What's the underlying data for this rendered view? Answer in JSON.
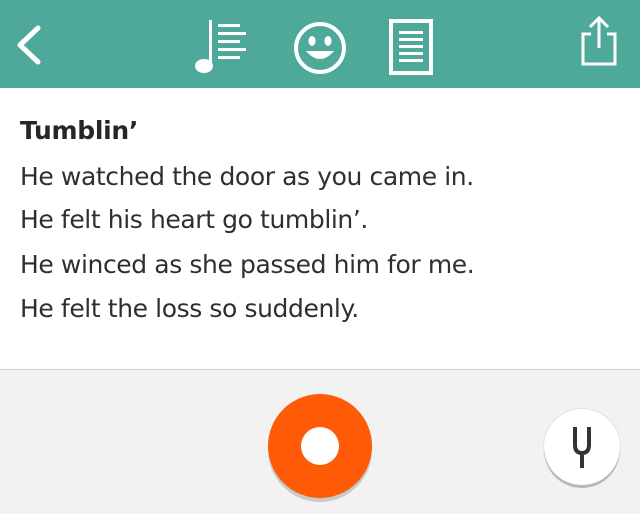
{
  "toolbar": {
    "icons": [
      "back-chevron-icon",
      "lyrics-notes-icon",
      "smiley-icon",
      "document-icon",
      "share-icon"
    ],
    "background": "#4fa99a",
    "active_tab": "lyrics-notes-icon"
  },
  "lyrics": {
    "title": "Tumblin’",
    "lines": [
      "He watched the door as you came in.",
      "He felt his heart go tumblin’.",
      "He winced as she passed him for me.",
      "He felt the loss so suddenly."
    ]
  },
  "controls": {
    "record_color": "#ff5a06",
    "record_icon": "record-icon",
    "tuner_icon": "tuning-fork-icon"
  }
}
